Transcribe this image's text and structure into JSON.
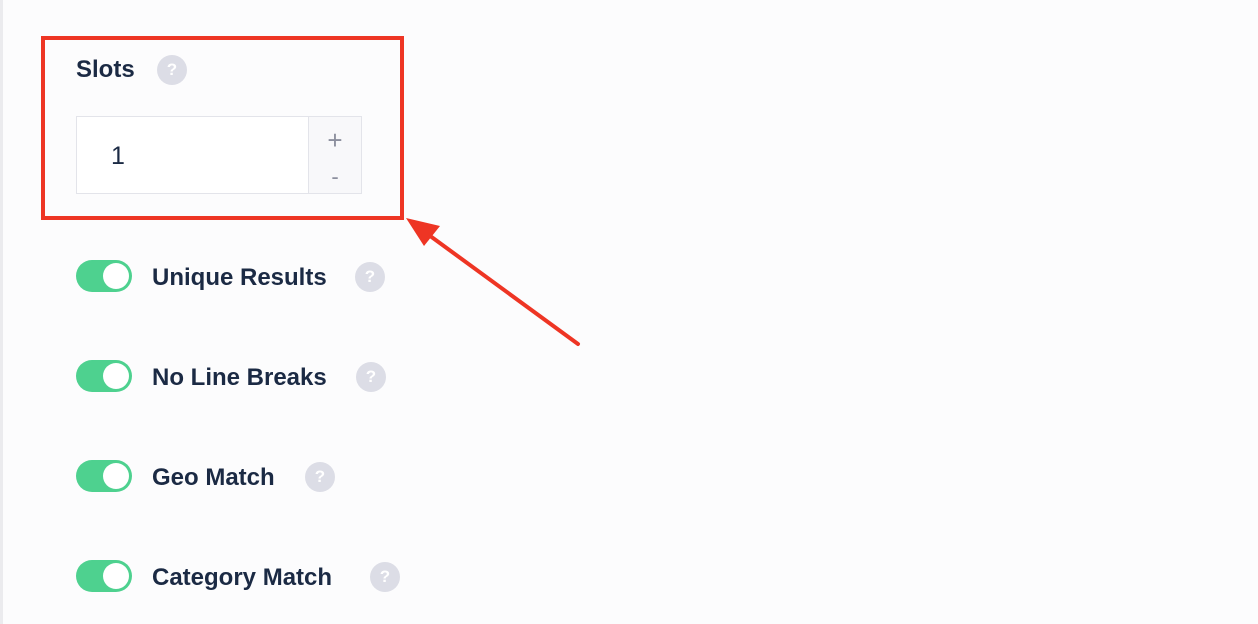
{
  "slots": {
    "label": "Slots",
    "help_glyph": "?",
    "value": "1",
    "increment_glyph": "+",
    "decrement_glyph": "-"
  },
  "toggles": [
    {
      "label": "Unique Results",
      "enabled": true,
      "help_glyph": "?"
    },
    {
      "label": "No Line Breaks",
      "enabled": true,
      "help_glyph": "?"
    },
    {
      "label": "Geo Match",
      "enabled": true,
      "help_glyph": "?"
    },
    {
      "label": "Category Match",
      "enabled": true,
      "help_glyph": "?"
    }
  ],
  "colors": {
    "toggle_on": "#4ed18f",
    "highlight": "#ee3524",
    "label_text": "#1b2a44",
    "help_icon_bg": "#dcdde6"
  },
  "icons": [
    "question-mark-help-icon",
    "plus-icon",
    "minus-icon",
    "annotation-arrow-icon"
  ]
}
